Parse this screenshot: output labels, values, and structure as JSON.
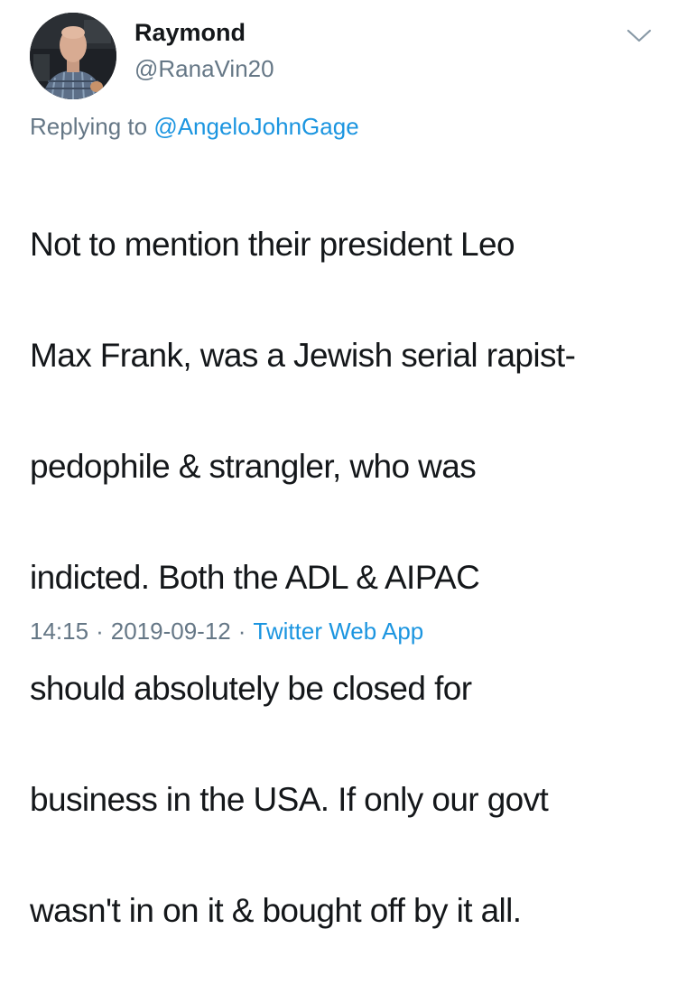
{
  "author": {
    "name": "Raymond",
    "handle": "@RanaVin20"
  },
  "reply": {
    "prefix": "Replying to",
    "mention": "@AngeloJohnGage"
  },
  "tweet": {
    "lines": [
      "Not to mention their president Leo",
      "Max Frank, was a Jewish serial rapist-",
      "pedophile & strangler, who was",
      "indicted. Both the ADL & AIPAC",
      "should absolutely be closed for",
      "business in the USA. If only our govt",
      "wasn't in on it & bought off by it all."
    ]
  },
  "meta": {
    "time": "14:15",
    "date": "2019-09-12",
    "separator": "·",
    "source": "Twitter Web App"
  },
  "icons": {
    "menu": "chevron-down-icon"
  },
  "colors": {
    "text": "#14171a",
    "secondary": "#657786",
    "link": "#1b95e0"
  }
}
